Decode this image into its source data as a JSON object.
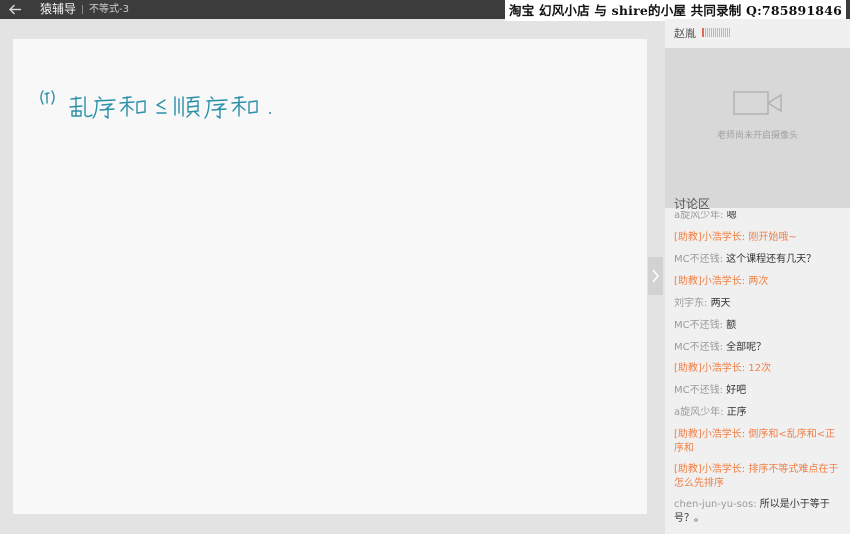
{
  "titlebar": {
    "app_title": "猿辅导",
    "lesson_title": "不等式-3",
    "watermark": "淘宝 幻风小店 与 shire的小屋 共同录制 Q:785891846"
  },
  "whiteboard": {
    "handwriting_text": "(1) 乱序和 ≤ 顺序和 ."
  },
  "teacher": {
    "name": "赵胤",
    "camera_status": "老师尚未开启摄像头"
  },
  "chat": {
    "title": "讨论区",
    "messages": [
      {
        "sender": "a旋风少年:",
        "text": "嗯",
        "role": "student"
      },
      {
        "sender": "[助教]小浩学长:",
        "text": "刚开始哦~",
        "role": "assistant"
      },
      {
        "sender": "MC不还钱:",
        "text": "这个课程还有几天？",
        "role": "student"
      },
      {
        "sender": "[助教]小浩学长:",
        "text": "两次",
        "role": "assistant"
      },
      {
        "sender": "刘宇东:",
        "text": "两天",
        "role": "student"
      },
      {
        "sender": "MC不还钱:",
        "text": "额",
        "role": "student"
      },
      {
        "sender": "MC不还钱:",
        "text": "全部呢？",
        "role": "student"
      },
      {
        "sender": "[助教]小浩学长:",
        "text": "12次",
        "role": "assistant"
      },
      {
        "sender": "MC不还钱:",
        "text": "好吧",
        "role": "student"
      },
      {
        "sender": "a旋风少年:",
        "text": "正序",
        "role": "student"
      },
      {
        "sender": "[助教]小浩学长:",
        "text": "倒序和<乱序和<正序和",
        "role": "assistant"
      },
      {
        "sender": "[助教]小浩学长:",
        "text": "排序不等式难点在于怎么先排序",
        "role": "assistant"
      },
      {
        "sender": "chen-jun-yu-sos:",
        "text": "所以是小于等于号？。",
        "role": "student"
      }
    ]
  },
  "colors": {
    "titlebar_bg": "#3c3c3c",
    "assistant_text": "#f07f44",
    "ink": "#2a8fa8"
  }
}
